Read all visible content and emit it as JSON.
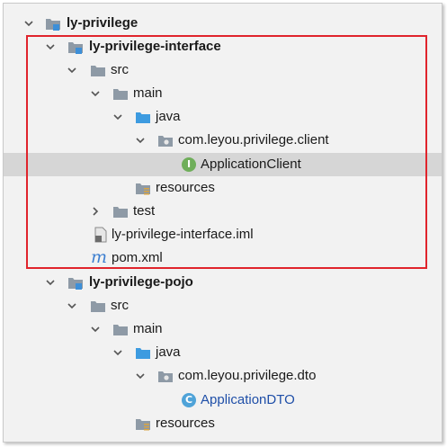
{
  "tree": {
    "root": {
      "label": "ly-privilege",
      "icon": "module-folder-icon"
    },
    "interface_module": {
      "label": "ly-privilege-interface",
      "icon": "module-folder-icon"
    },
    "interface_src": {
      "label": "src",
      "icon": "folder-icon"
    },
    "interface_main": {
      "label": "main",
      "icon": "folder-icon"
    },
    "interface_java": {
      "label": "java",
      "icon": "source-folder-icon"
    },
    "interface_package": {
      "label": "com.leyou.privilege.client",
      "icon": "package-icon"
    },
    "interface_class": {
      "label": "ApplicationClient",
      "icon": "interface-icon",
      "badge": "I"
    },
    "interface_resources": {
      "label": "resources",
      "icon": "resources-folder-icon"
    },
    "interface_test": {
      "label": "test",
      "icon": "folder-icon"
    },
    "interface_iml": {
      "label": "ly-privilege-interface.iml",
      "icon": "iml-file-icon"
    },
    "interface_pom": {
      "label": "pom.xml",
      "icon": "maven-icon",
      "badge": "m"
    },
    "pojo_module": {
      "label": "ly-privilege-pojo",
      "icon": "module-folder-icon"
    },
    "pojo_src": {
      "label": "src",
      "icon": "folder-icon"
    },
    "pojo_main": {
      "label": "main",
      "icon": "folder-icon"
    },
    "pojo_java": {
      "label": "java",
      "icon": "source-folder-icon"
    },
    "pojo_package": {
      "label": "com.leyou.privilege.dto",
      "icon": "package-icon"
    },
    "pojo_class": {
      "label": "ApplicationDTO",
      "icon": "class-icon",
      "badge": "C"
    },
    "pojo_resources": {
      "label": "resources",
      "icon": "resources-folder-icon"
    }
  },
  "colors": {
    "highlight_box": "#e0242c",
    "selection": "#d6d6d6",
    "class_label": "#1f4fa8"
  }
}
